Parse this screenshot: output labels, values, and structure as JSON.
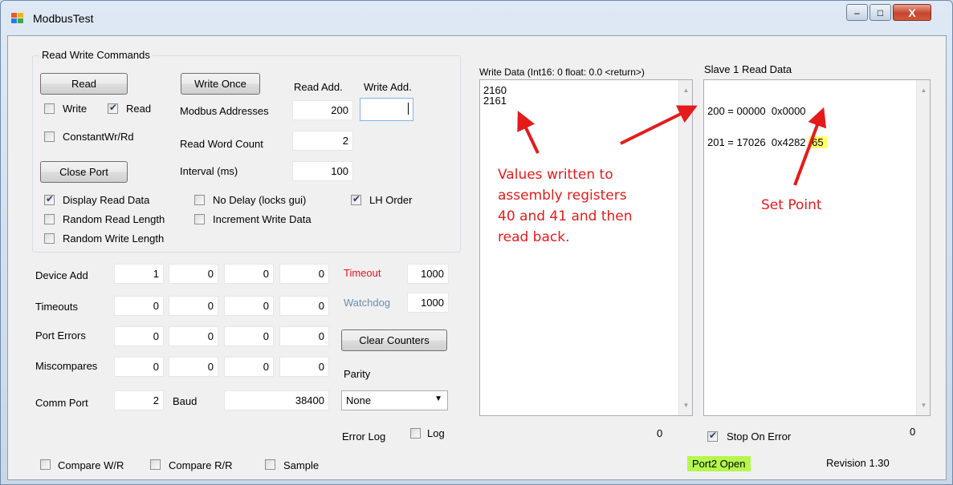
{
  "window": {
    "title": "ModbusTest",
    "min_symbol": "–",
    "max_symbol": "□",
    "close_symbol": "X"
  },
  "commands": {
    "group_title": "Read Write Commands",
    "read_button": "Read",
    "write_once_button": "Write Once",
    "close_port_button": "Close Port",
    "write_label": "Write",
    "read_label": "Read",
    "constant_label": "ConstantWr/Rd",
    "read_add_header": "Read Add.",
    "write_add_header": "Write Add.",
    "modbus_addresses_label": "Modbus Addresses",
    "modbus_read_address": "200",
    "modbus_write_address": "",
    "read_word_count_label": "Read Word Count",
    "read_word_count": "2",
    "interval_label": "Interval (ms)",
    "interval": "100",
    "display_read_data_label": "Display Read Data",
    "no_delay_label": "No Delay (locks gui)",
    "lh_order_label": "LH Order",
    "random_read_length_label": "Random Read Length",
    "increment_write_data_label": "Increment Write Data",
    "random_write_length_label": "Random Write Length",
    "checked": {
      "write": false,
      "read": true,
      "constant": false,
      "display_read_data": true,
      "no_delay": false,
      "lh_order": true,
      "random_read_length": false,
      "increment_write_data": false,
      "random_write_length": false
    }
  },
  "counters": {
    "device_add_label": "Device Add",
    "device_add": [
      "1",
      "0",
      "0",
      "0"
    ],
    "timeouts_label": "Timeouts",
    "timeouts": [
      "0",
      "0",
      "0",
      "0"
    ],
    "port_errors_label": "Port Errors",
    "port_errors": [
      "0",
      "0",
      "0",
      "0"
    ],
    "miscompares_label": "Miscompares",
    "miscompares": [
      "0",
      "0",
      "0",
      "0"
    ],
    "comm_port_label": "Comm Port",
    "comm_port": "2",
    "baud_label": "Baud",
    "baud": "38400",
    "timeout_label": "Timeout",
    "timeout": "1000",
    "watchdog_label": "Watchdog",
    "watchdog": "1000",
    "clear_counters_button": "Clear Counters",
    "parity_label": "Parity",
    "parity_value": "None",
    "error_log_label": "Error Log",
    "log_label": "Log",
    "log_checked": false
  },
  "bottom": {
    "compare_wr_label": "Compare W/R",
    "compare_rr_label": "Compare R/R",
    "sample_label": "Sample",
    "status": "Port2 Open",
    "revision": "Revision 1.30"
  },
  "write_data": {
    "header": "Write Data (Int16: 0 float: 0.0 <return>)",
    "lines": [
      "2160",
      "2161"
    ],
    "count": "0"
  },
  "read_data": {
    "header": "Slave 1 Read Data",
    "line1": "200 = 00000  0x0000",
    "line2_prefix": "201 = 17026  0x4282",
    "line2_highlight": "65",
    "count": "0",
    "stop_on_error_label": "Stop On Error",
    "stop_on_error_checked": true
  },
  "annotations": {
    "values_note": [
      "Values written to",
      "assembly registers",
      "40 and 41 and then",
      "read back."
    ],
    "set_point_note": "Set Point",
    "color": "#e51b1b"
  },
  "colors": {
    "status_bg": "#b5f74d",
    "highlight": "#ffff66",
    "timeout_label": "#e81123",
    "watchdog_label": "#6b8bb5"
  }
}
